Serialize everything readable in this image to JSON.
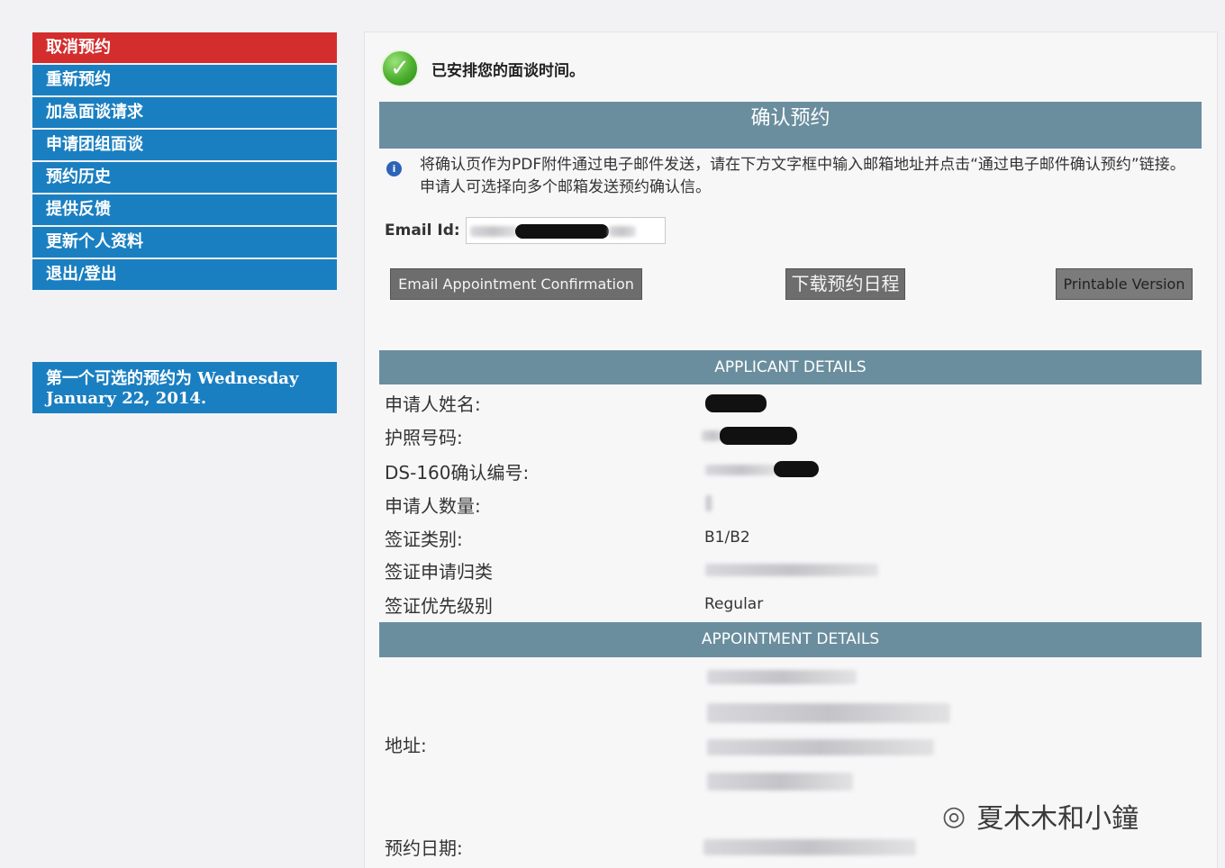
{
  "sidebar": {
    "items": [
      {
        "label": "取消预约"
      },
      {
        "label": "重新预约"
      },
      {
        "label": "加急面谈请求"
      },
      {
        "label": "申请团组面谈"
      },
      {
        "label": "预约历史"
      },
      {
        "label": "提供反馈"
      },
      {
        "label": "更新个人资料"
      },
      {
        "label": "退出/登出"
      }
    ],
    "note": "第一个可选的预约为 Wednesday January 22, 2014."
  },
  "status": {
    "message": "已安排您的面谈时间。"
  },
  "confirm": {
    "title": "确认预约",
    "info": "将确认页作为PDF附件通过电子邮件发送，请在下方文字框中输入邮箱地址并点击“通过电子邮件确认预约”链接。申请人可选择向多个邮箱发送预约确认信。",
    "email_label": "Email Id:",
    "buttons": {
      "email": "Email Appointment Confirmation",
      "download": "下载预约日程",
      "print": "Printable Version"
    }
  },
  "applicant": {
    "title": "APPLICANT DETAILS",
    "fields": [
      {
        "label": "申请人姓名:"
      },
      {
        "label": "护照号码:"
      },
      {
        "label": "DS-160确认编号:"
      },
      {
        "label": "申请人数量:"
      },
      {
        "label": "签证类别:",
        "value": "B1/B2"
      },
      {
        "label": "签证申请归类"
      },
      {
        "label": "签证优先级别",
        "value": "Regular"
      }
    ]
  },
  "appointment": {
    "title": "APPOINTMENT DETAILS",
    "address_label": "地址:",
    "date_label": "预约日期:"
  },
  "watermark": {
    "text": "夏木木和小鐘",
    "icon": "wechat-icon"
  }
}
